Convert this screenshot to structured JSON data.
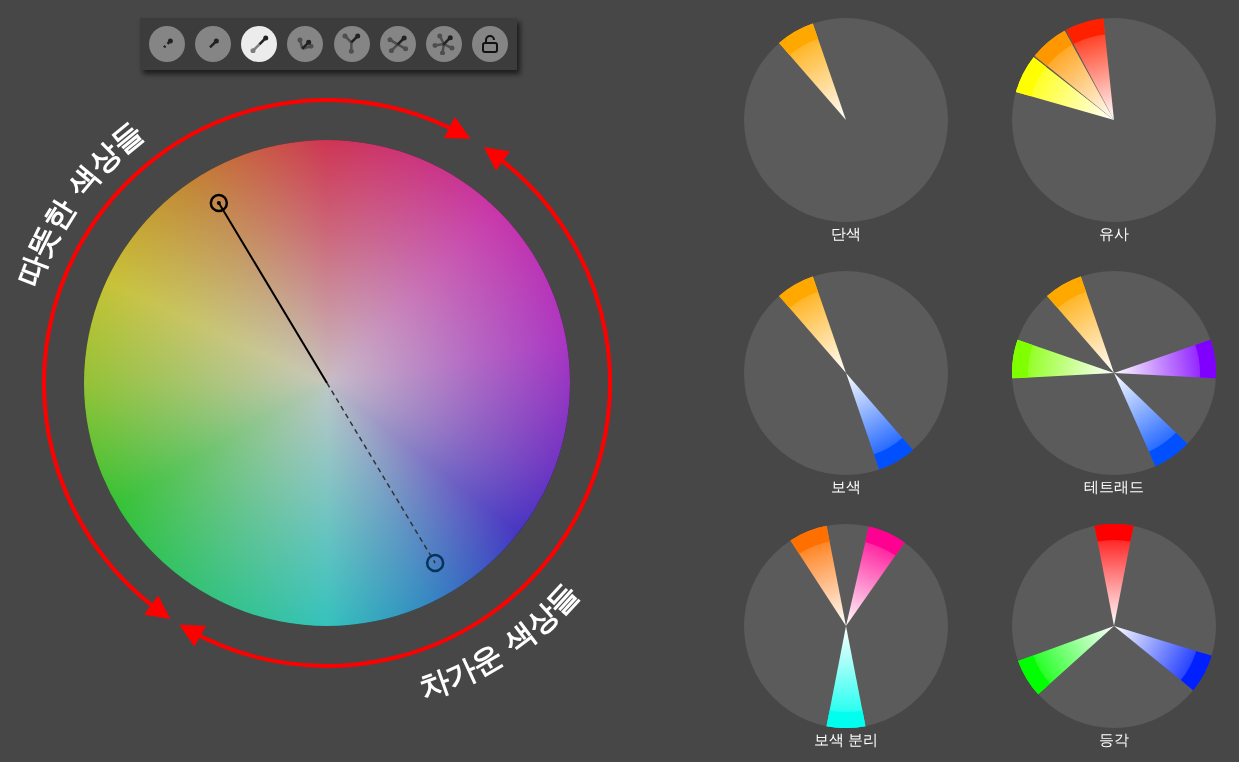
{
  "toolbar": {
    "buttons": [
      {
        "kind": "mono",
        "selected": false
      },
      {
        "kind": "single",
        "selected": false
      },
      {
        "kind": "complement",
        "selected": true
      },
      {
        "kind": "triad-narrow",
        "selected": false
      },
      {
        "kind": "split",
        "selected": false
      },
      {
        "kind": "tetrad",
        "selected": false
      },
      {
        "kind": "pentad",
        "selected": false
      },
      {
        "kind": "lock",
        "selected": false
      }
    ]
  },
  "wheel": {
    "warm_label": "따뜻한 색상들",
    "cool_label": "차가운 색상들"
  },
  "harmonies": [
    {
      "label": "단색",
      "kind": "mono",
      "wedges": [
        {
          "color": "#ffa800"
        }
      ]
    },
    {
      "label": "유사",
      "kind": "analogous",
      "wedges": [
        {
          "color": "#ffff00"
        },
        {
          "color": "#ff9800"
        },
        {
          "color": "#ff2000"
        }
      ]
    },
    {
      "label": "보색",
      "kind": "complementary",
      "wedges": [
        {
          "color": "#ffa800"
        },
        {
          "color": "#0050ff"
        }
      ]
    },
    {
      "label": "테트래드",
      "kind": "tetrad",
      "wedges": [
        {
          "color": "#ffa800"
        },
        {
          "color": "#80ff00"
        },
        {
          "color": "#8000ff"
        },
        {
          "color": "#0050ff"
        }
      ]
    },
    {
      "label": "보색 분리",
      "kind": "split",
      "wedges": [
        {
          "color": "#ff7000"
        },
        {
          "color": "#ff0090"
        },
        {
          "color": "#00ffee"
        }
      ]
    },
    {
      "label": "등각",
      "kind": "triad",
      "wedges": [
        {
          "color": "#ff0000"
        },
        {
          "color": "#0020ff"
        },
        {
          "color": "#00ff00"
        }
      ]
    }
  ]
}
